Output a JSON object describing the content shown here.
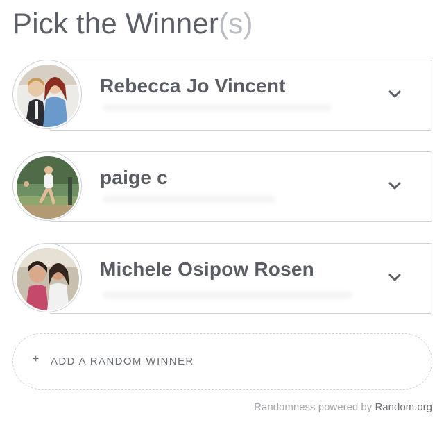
{
  "header": {
    "title": "Pick the Winner",
    "title_suffix": "(s)"
  },
  "winners": [
    {
      "name": "Rebecca Jo Vincent",
      "avatar": "avatar-photo-two-people"
    },
    {
      "name": "paige c",
      "avatar": "avatar-photo-runner"
    },
    {
      "name": "Michele Osipow Rosen",
      "avatar": "avatar-photo-two-girls"
    }
  ],
  "actions": {
    "plus": "+",
    "add_random_winner": "ADD A RANDOM WINNER"
  },
  "footer": {
    "powered_prefix": "Randomness powered by",
    "powered_link": "Random.org"
  },
  "icons": {
    "expand": "chevron-down-icon",
    "add": "plus-icon"
  },
  "colors": {
    "text": "#5a5e64",
    "muted": "#b9bcc0",
    "border": "#cfd2d6"
  }
}
